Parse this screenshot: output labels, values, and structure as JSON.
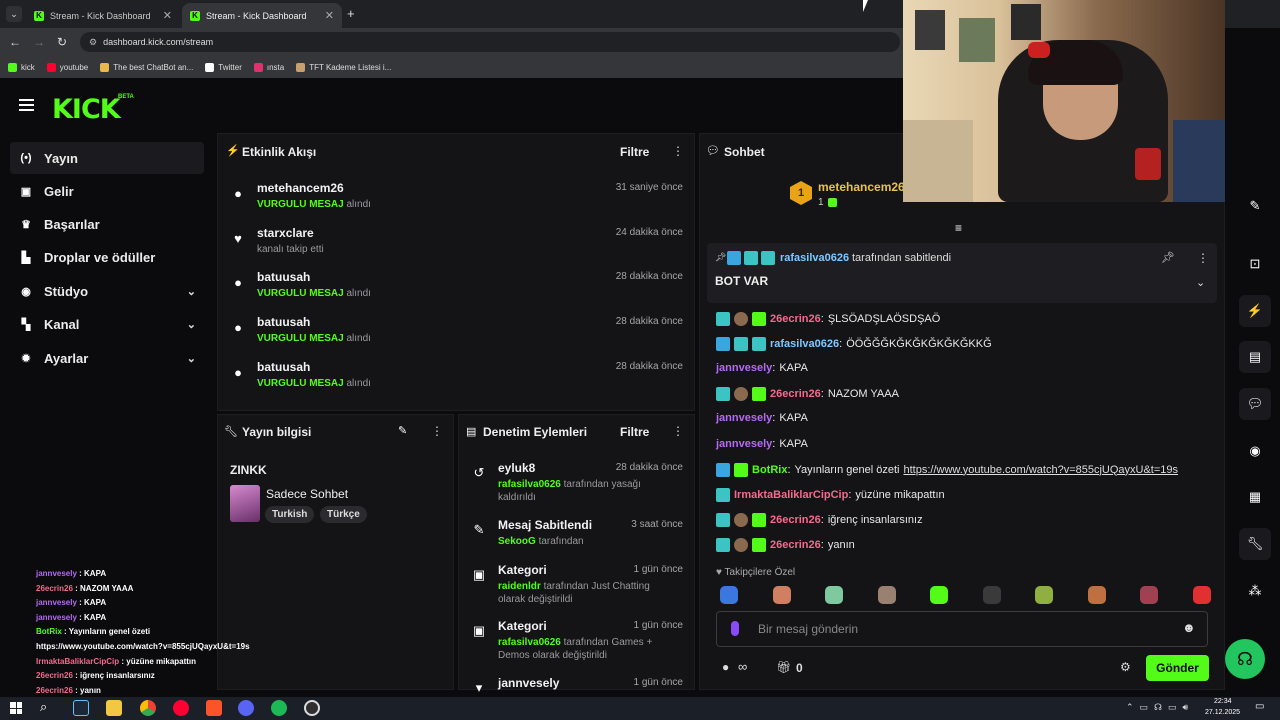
{
  "browser": {
    "tabs": [
      {
        "title": "Stream - Kick Dashboard"
      },
      {
        "title": "Stream - Kick Dashboard"
      }
    ],
    "url": "dashboard.kick.com/stream",
    "bookmarks": [
      {
        "label": "kick",
        "color": "#53fc18"
      },
      {
        "label": "youtube",
        "color": "#ff0033"
      },
      {
        "label": "The best ChatBot an...",
        "color": "#e8b84a"
      },
      {
        "label": "Twitter",
        "color": "#ffffff"
      },
      {
        "label": "ınsta",
        "color": "#e1306c"
      },
      {
        "label": "TFT Kademe Listesi i...",
        "color": "#c8a070"
      }
    ]
  },
  "brand": {
    "logo": "KICK",
    "beta": "BETA",
    "accent": "#53fc18"
  },
  "sidebar": {
    "items": [
      {
        "label": "Yayın",
        "icon": "broadcast-icon",
        "glyph": "(•)",
        "active": true,
        "chevron": false
      },
      {
        "label": "Gelir",
        "icon": "revenue-icon",
        "glyph": "▣",
        "active": false,
        "chevron": false
      },
      {
        "label": "Başarılar",
        "icon": "trophy-icon",
        "glyph": "♛",
        "active": false,
        "chevron": false
      },
      {
        "label": "Droplar ve ödüller",
        "icon": "drops-icon",
        "glyph": "▙",
        "active": false,
        "chevron": false
      },
      {
        "label": "Stüdyo",
        "icon": "studio-icon",
        "glyph": "◉",
        "active": false,
        "chevron": true
      },
      {
        "label": "Kanal",
        "icon": "channel-icon",
        "glyph": "▚",
        "active": false,
        "chevron": true
      },
      {
        "label": "Ayarlar",
        "icon": "settings-icon",
        "glyph": "✹",
        "active": false,
        "chevron": true
      }
    ]
  },
  "activity": {
    "title": "Etkinlik Akışı",
    "filter": "Filtre",
    "events": [
      {
        "name": "metehancem26",
        "highlight": "VURGULU MESAJ",
        "rest": "alındı",
        "time": "31 saniye önce",
        "icon": "dots-icon",
        "glyph": "●"
      },
      {
        "name": "starxclare",
        "highlight": "",
        "rest": "kanalı takip etti",
        "time": "24 dakika önce",
        "icon": "heart-icon",
        "glyph": "♥"
      },
      {
        "name": "batuusah",
        "highlight": "VURGULU MESAJ",
        "rest": "alındı",
        "time": "28 dakika önce",
        "icon": "dots-icon",
        "glyph": "●"
      },
      {
        "name": "batuusah",
        "highlight": "VURGULU MESAJ",
        "rest": "alındı",
        "time": "28 dakika önce",
        "icon": "dots-icon",
        "glyph": "●"
      },
      {
        "name": "batuusah",
        "highlight": "VURGULU MESAJ",
        "rest": "alındı",
        "time": "28 dakika önce",
        "icon": "dots-icon",
        "glyph": "●"
      }
    ]
  },
  "stream_info": {
    "title": "Yayın bilgisi",
    "stream_title": "ZINKK",
    "category": "Sadece Sohbet",
    "tags": [
      "Turkish",
      "Türkçe"
    ]
  },
  "moderation": {
    "title": "Denetim Eylemleri",
    "filter": "Filtre",
    "items": [
      {
        "name": "eyluk8",
        "time": "28 dakika önce",
        "user": "rafasilva0626",
        "text": "tarafından yasağı kaldırıldı",
        "extra": "",
        "glyph": "↺"
      },
      {
        "name": "Mesaj Sabitlendi",
        "time": "3 saat önce",
        "user": "SekooG",
        "text": "tarafından",
        "extra": "",
        "glyph": "✎"
      },
      {
        "name": "Kategori",
        "time": "1 gün önce",
        "user": "raidenldr",
        "text": "tarafından Just Chatting olarak değiştirildi",
        "extra": "",
        "glyph": "▣"
      },
      {
        "name": "Kategori",
        "time": "1 gün önce",
        "user": "rafasilva0626",
        "text": "tarafından Games + Demos olarak değiştirildi",
        "extra": "",
        "glyph": "▣"
      },
      {
        "name": "jannvesely",
        "time": "1 gün önce",
        "user": "",
        "text": "",
        "extra": "",
        "glyph": "▾"
      }
    ]
  },
  "chat": {
    "title": "Sohbet",
    "top_gifter": {
      "name": "metehancem26",
      "count": "1",
      "rank": "1"
    },
    "pinned": {
      "by": "rafasilva0626",
      "by_text": "tarafından sabitlendi",
      "message": "BOT VAR"
    },
    "messages": [
      {
        "user": "26ecrin26",
        "cls": "u-pink",
        "text": "ŞLSÖADŞLAÖSDŞAÖ",
        "badges": [
          "b-teal",
          "b-brown",
          "b-green"
        ]
      },
      {
        "user": "rafasilva0626",
        "cls": "u-blue",
        "text": "ÖÖĞĞĞKĞKĞKĞKĞKĞKKĞ",
        "badges": [
          "b-blue",
          "b-teal",
          "b-teal"
        ]
      },
      {
        "user": "jannvesely",
        "cls": "u-purple",
        "text": "KAPA",
        "badges": []
      },
      {
        "user": "26ecrin26",
        "cls": "u-pink",
        "text": "NAZOM YAAA",
        "badges": [
          "b-teal",
          "b-brown",
          "b-green"
        ]
      },
      {
        "user": "jannvesely",
        "cls": "u-purple",
        "text": "KAPA",
        "badges": []
      },
      {
        "user": "jannvesely",
        "cls": "u-purple",
        "text": "KAPA",
        "badges": []
      },
      {
        "user": "BotRix",
        "cls": "u-green",
        "text": "Yayınların genel özeti",
        "link": "https://www.youtube.com/watch?v=855cjUQayxU&t=19s",
        "badges": [
          "b-blue",
          "b-green"
        ]
      },
      {
        "user": "IrmaktaBaliklarCipCip",
        "cls": "u-pink",
        "text": "yüzüne mikapattın",
        "badges": [
          "b-teal"
        ]
      },
      {
        "user": "26ecrin26",
        "cls": "u-pink",
        "text": "iğrenç insanlarsınız",
        "badges": [
          "b-teal",
          "b-brown",
          "b-green"
        ]
      },
      {
        "user": "26ecrin26",
        "cls": "u-pink",
        "text": "yanın",
        "badges": [
          "b-teal",
          "b-brown",
          "b-green"
        ]
      }
    ],
    "followers_only": "Takipçilere Özel",
    "input_placeholder": "Bir mesaj gönderin",
    "points": "∞",
    "gift_count": "0",
    "send": "Gönder"
  },
  "overlay_chat": [
    {
      "user": "jannvesely",
      "text": "KAPA",
      "cls": "u"
    },
    {
      "user": "26ecrin26",
      "text": "NAZOM YAAA",
      "cls": "u2"
    },
    {
      "user": "jannvesely",
      "text": "KAPA",
      "cls": "u"
    },
    {
      "user": "jannvesely",
      "text": "KAPA",
      "cls": "u"
    },
    {
      "user": "BotRix",
      "text": "Yayınların genel özeti",
      "cls": "u3"
    },
    {
      "user": "",
      "text": "https://www.youtube.com/watch?v=855cjUQayxU&t=19s",
      "cls": "u3"
    },
    {
      "user": "IrmaktaBaliklarCipCip",
      "text": "yüzüne mikapattın",
      "cls": "u2"
    },
    {
      "user": "26ecrin26",
      "text": "iğrenç insanlarsınız",
      "cls": "u2"
    },
    {
      "user": "26ecrin26",
      "text": "yanın",
      "cls": "u2"
    }
  ],
  "taskbar": {
    "time": "22:34",
    "date": "27.12.2025"
  }
}
